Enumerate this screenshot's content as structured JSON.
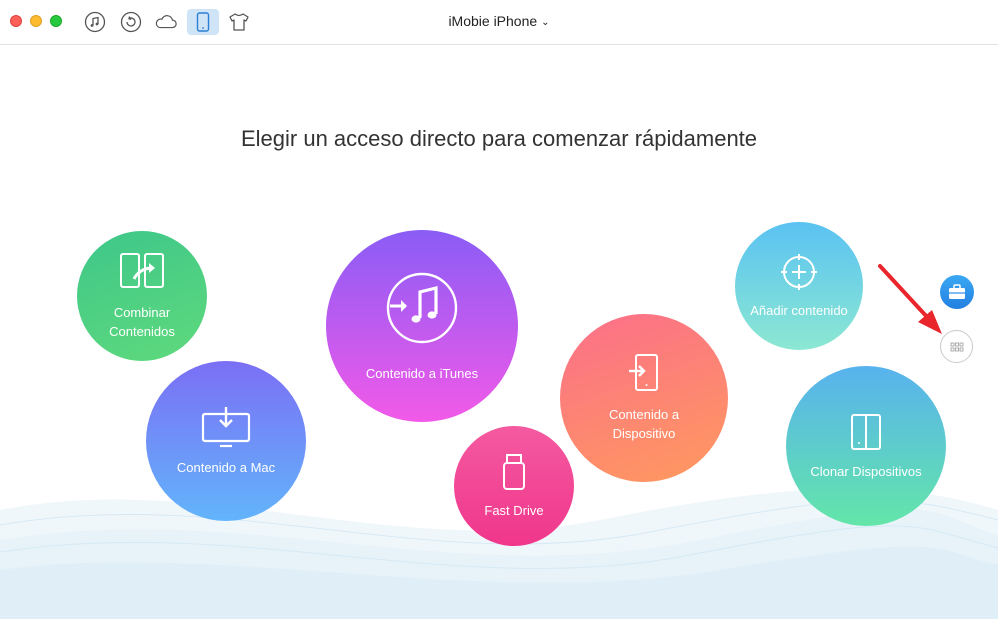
{
  "window": {
    "title": "iMobie iPhone"
  },
  "toolbar": {
    "icons": [
      "music-note-icon",
      "restore-icon",
      "cloud-icon",
      "phone-icon",
      "tshirt-icon"
    ],
    "active_icon": "phone-icon"
  },
  "main": {
    "heading": "Elegir un acceso directo para comenzar rápidamente"
  },
  "shortcuts": {
    "combinar": {
      "label": "Combinar Contenidos",
      "icon": "merge-icon",
      "color": "#4ccf84"
    },
    "mac": {
      "label": "Contenido a Mac",
      "icon": "monitor-download-icon",
      "color": "#6f95f8"
    },
    "itunes": {
      "label": "Contenido a iTunes",
      "icon": "itunes-icon",
      "color": "#b35bf0"
    },
    "fast": {
      "label": "Fast Drive",
      "icon": "usb-drive-icon",
      "color": "#f2479a"
    },
    "disp": {
      "label": "Contenido a Dispositivo",
      "icon": "device-import-icon",
      "color": "#fc8274"
    },
    "anadir": {
      "label": "Añadir contenido",
      "icon": "add-circle-icon",
      "color": "#6fd3e6"
    },
    "clonar": {
      "label": "Clonar Dispositivos",
      "icon": "clone-device-icon",
      "color": "#5ecbcf"
    }
  },
  "side": {
    "toolbox_icon": "toolbox-icon",
    "more_icon": "grid-dots-icon",
    "accent": "#2b8ee8",
    "arrow_color": "#e8262b"
  }
}
